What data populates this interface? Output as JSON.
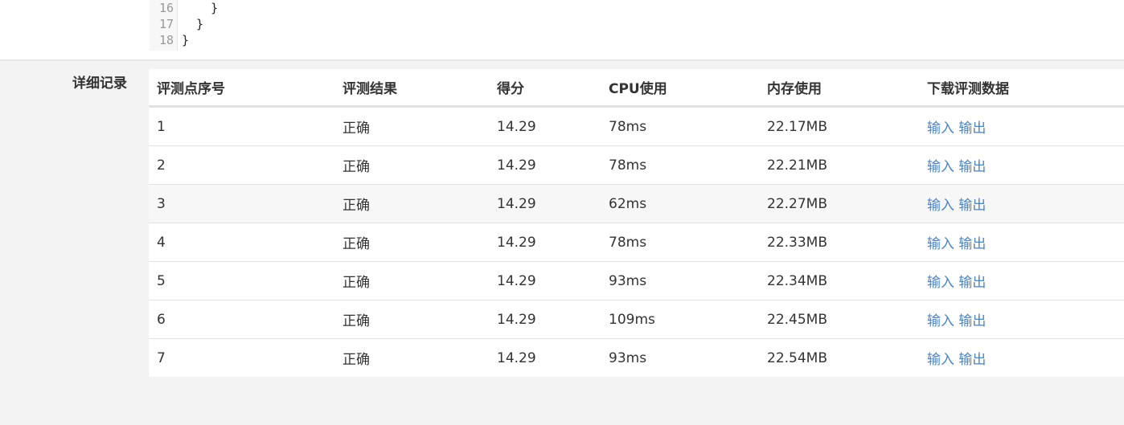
{
  "code": {
    "lines": [
      {
        "num": "16",
        "text": "    }"
      },
      {
        "num": "17",
        "text": "  }"
      },
      {
        "num": "18",
        "text": "}"
      }
    ]
  },
  "records": {
    "label": "详细记录",
    "headers": [
      "评测点序号",
      "评测结果",
      "得分",
      "CPU使用",
      "内存使用",
      "下载评测数据"
    ],
    "input_label": "输入",
    "output_label": "输出",
    "rows": [
      {
        "id": "1",
        "result": "正确",
        "score": "14.29",
        "cpu": "78ms",
        "mem": "22.17MB"
      },
      {
        "id": "2",
        "result": "正确",
        "score": "14.29",
        "cpu": "78ms",
        "mem": "22.21MB"
      },
      {
        "id": "3",
        "result": "正确",
        "score": "14.29",
        "cpu": "62ms",
        "mem": "22.27MB"
      },
      {
        "id": "4",
        "result": "正确",
        "score": "14.29",
        "cpu": "78ms",
        "mem": "22.33MB"
      },
      {
        "id": "5",
        "result": "正确",
        "score": "14.29",
        "cpu": "93ms",
        "mem": "22.34MB"
      },
      {
        "id": "6",
        "result": "正确",
        "score": "14.29",
        "cpu": "109ms",
        "mem": "22.45MB"
      },
      {
        "id": "7",
        "result": "正确",
        "score": "14.29",
        "cpu": "93ms",
        "mem": "22.54MB"
      }
    ]
  }
}
